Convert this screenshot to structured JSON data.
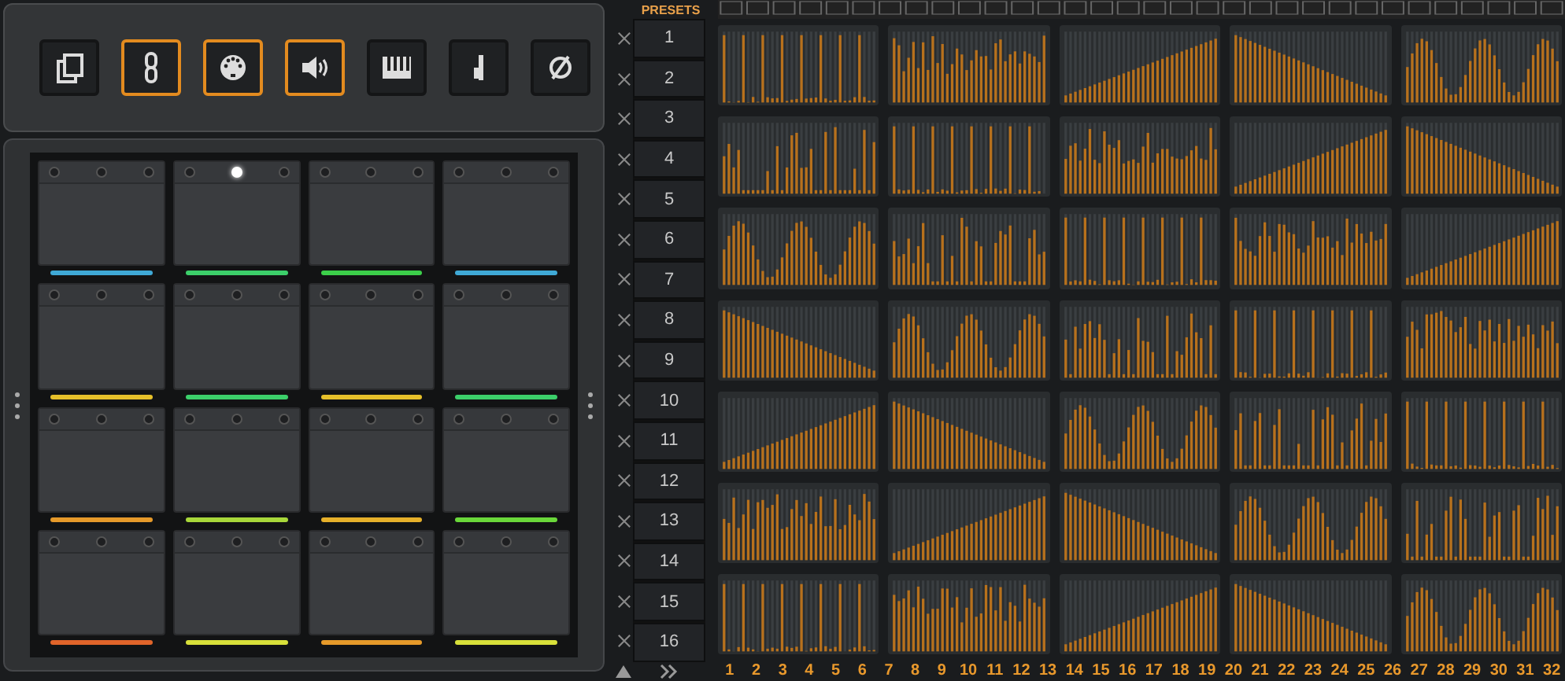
{
  "toolbar": {
    "buttons": [
      {
        "selected": false
      },
      {
        "selected": true
      },
      {
        "selected": true
      },
      {
        "selected": true
      },
      {
        "selected": false
      },
      {
        "selected": false
      },
      {
        "selected": false
      }
    ]
  },
  "pads": [
    {
      "color": "#3fa9d6",
      "lit": false
    },
    {
      "color": "#3ccf6a",
      "lit": true
    },
    {
      "color": "#3ccf4a",
      "lit": false
    },
    {
      "color": "#3fa9d6",
      "lit": false
    },
    {
      "color": "#e6c02a",
      "lit": false
    },
    {
      "color": "#3ccf6a",
      "lit": false
    },
    {
      "color": "#e6c02a",
      "lit": false
    },
    {
      "color": "#3ccf6a",
      "lit": false
    },
    {
      "color": "#e69a2a",
      "lit": false
    },
    {
      "color": "#a8d83a",
      "lit": false
    },
    {
      "color": "#e6b02a",
      "lit": false
    },
    {
      "color": "#6ad83a",
      "lit": false
    },
    {
      "color": "#e0642a",
      "lit": false
    },
    {
      "color": "#d8e03a",
      "lit": false
    },
    {
      "color": "#e69a2a",
      "lit": false
    },
    {
      "color": "#d8e03a",
      "lit": false
    }
  ],
  "presets": {
    "title": "PRESETS",
    "items": [
      {
        "label": "1"
      },
      {
        "label": "2"
      },
      {
        "label": "3"
      },
      {
        "label": "4"
      },
      {
        "label": "5"
      },
      {
        "label": "6"
      },
      {
        "label": "7"
      },
      {
        "label": "8"
      },
      {
        "label": "9"
      },
      {
        "label": "10"
      },
      {
        "label": "11"
      },
      {
        "label": "12"
      },
      {
        "label": "13"
      },
      {
        "label": "14"
      },
      {
        "label": "15"
      },
      {
        "label": "16"
      }
    ]
  },
  "steps": [
    "1",
    "2",
    "3",
    "4",
    "5",
    "6",
    "7",
    "8",
    "9",
    "10",
    "11",
    "12",
    "13",
    "14",
    "15",
    "16",
    "17",
    "18",
    "19",
    "20",
    "21",
    "22",
    "23",
    "24",
    "25",
    "26",
    "27",
    "28",
    "29",
    "30",
    "31",
    "32"
  ]
}
